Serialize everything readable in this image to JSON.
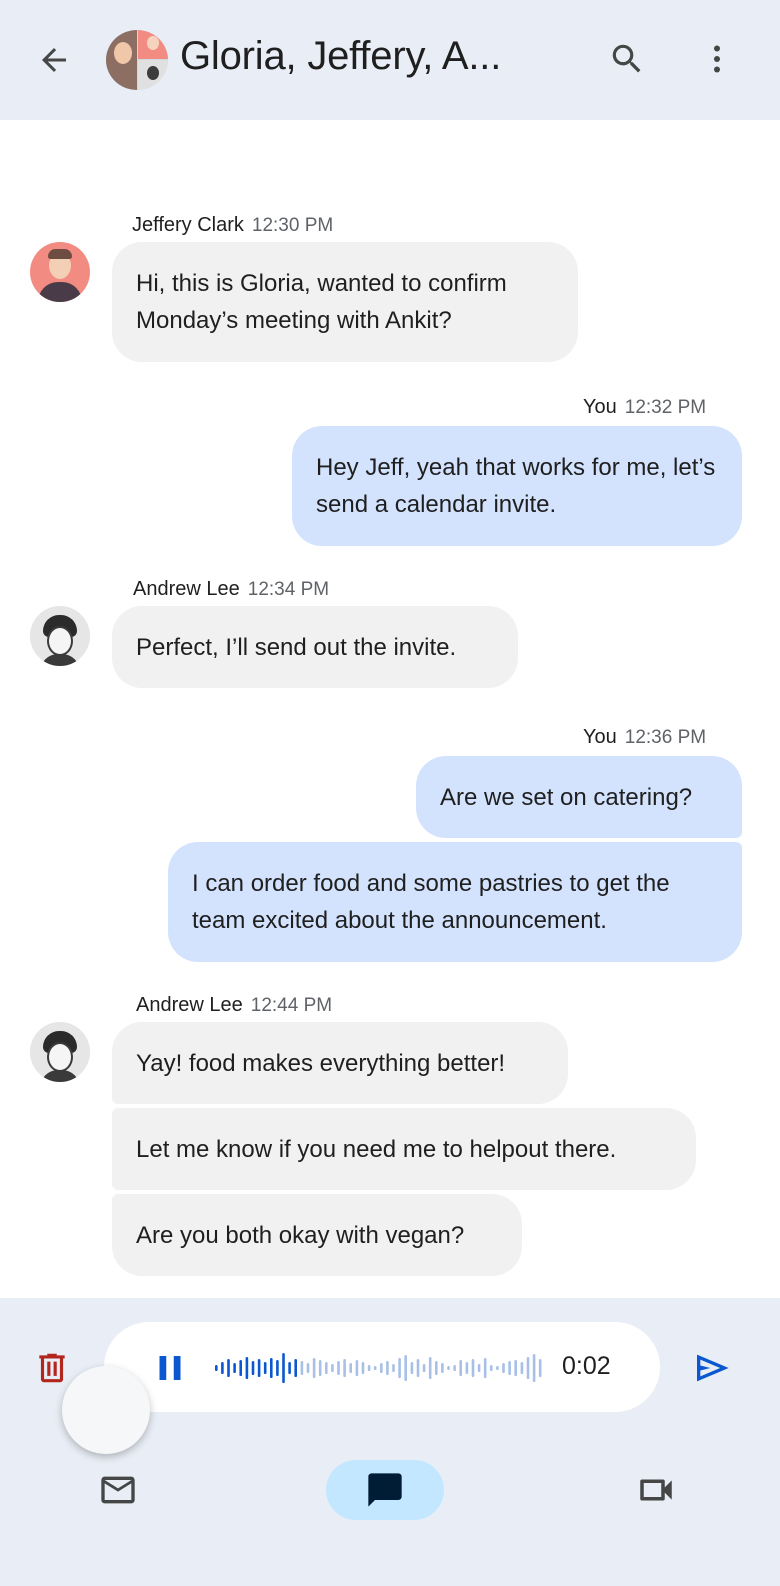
{
  "header": {
    "title": "Gloria, Jeffery, A...",
    "back_icon": "arrow-back-icon",
    "search_icon": "search-icon",
    "more_icon": "more-vert-icon"
  },
  "messages": [
    {
      "sender": "Jeffery Clark",
      "time": "12:30 PM",
      "direction": "incoming",
      "bubbles": [
        "Hi, this is Gloria, wanted to confirm Monday’s meeting with Ankit?"
      ]
    },
    {
      "sender": "You",
      "time": "12:32 PM",
      "direction": "outgoing",
      "bubbles": [
        "Hey Jeff, yeah that works for me, let’s send a calendar invite."
      ]
    },
    {
      "sender": "Andrew Lee",
      "time": "12:34 PM",
      "direction": "incoming",
      "bubbles": [
        "Perfect, I’ll send out the invite."
      ]
    },
    {
      "sender": "You",
      "time": "12:36 PM",
      "direction": "outgoing",
      "bubbles": [
        "Are we set on catering?",
        "I can order food and some pastries to get the team excited about the announcement."
      ]
    },
    {
      "sender": "Andrew Lee",
      "time": "12:44 PM",
      "direction": "incoming",
      "bubbles": [
        "Yay! food makes everything better!",
        "Let me know if you need me to helpout there.",
        "Are you both okay with vegan?"
      ]
    }
  ],
  "recorder": {
    "elapsed": "0:02",
    "trash_icon": "delete-icon",
    "pause_icon": "pause-icon",
    "send_icon": "send-icon"
  },
  "bottom_nav": [
    {
      "icon": "mail-icon",
      "selected": false
    },
    {
      "icon": "chat-icon",
      "selected": true
    },
    {
      "icon": "video-icon",
      "selected": false
    }
  ],
  "colors": {
    "header_bg": "#e9eef6",
    "incoming_bubble": "#f1f1f1",
    "outgoing_bubble": "#d3e3fd",
    "accent_blue": "#0b57d0",
    "trash_red": "#b3261e",
    "nav_selected": "#c2e7ff"
  }
}
